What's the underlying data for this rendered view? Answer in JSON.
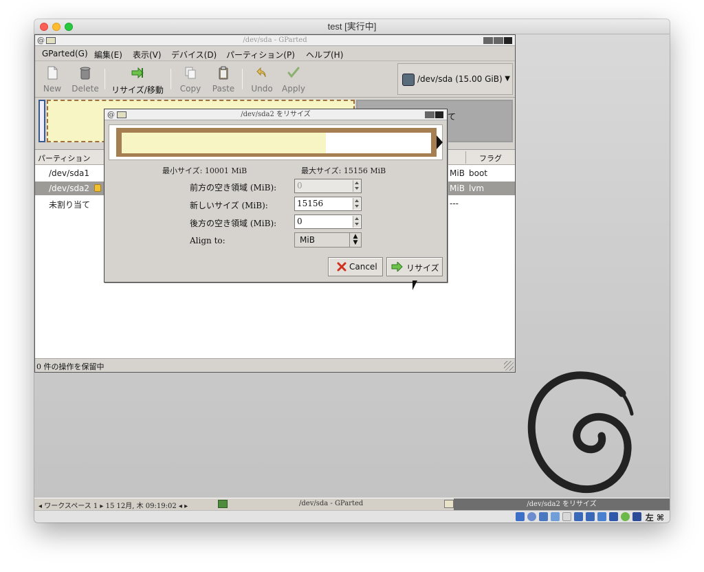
{
  "host": {
    "title": "test [実行中]"
  },
  "gparted": {
    "title": "/dev/sda - GParted",
    "menu": [
      "GParted(G)",
      "編集(E)",
      "表示(V)",
      "デバイス(D)",
      "パーティション(P)",
      "ヘルプ(H)"
    ],
    "toolbar": {
      "new": "New",
      "delete": "Delete",
      "resize_move": "リサイズ/移動",
      "copy": "Copy",
      "paste": "Paste",
      "undo": "Undo",
      "apply": "Apply"
    },
    "device": "/dev/sda  (15.00 GiB)",
    "graph_unalloc_fragment": "て",
    "columns": {
      "partition": "パーティション",
      "flags": "フラグ"
    },
    "rows": [
      {
        "partition": "/dev/sda1",
        "size_fragment": "MiB",
        "flags": "boot"
      },
      {
        "partition": "/dev/sda2",
        "size_fragment": "MiB",
        "flags": "lvm"
      },
      {
        "partition": "未割り当て",
        "size_fragment": "---",
        "flags": ""
      }
    ],
    "status": "0 件の操作を保留中"
  },
  "dialog": {
    "title": "/dev/sda2 をリサイズ",
    "resize_used_fraction": 0.66,
    "min_size": "最小サイズ: 10001 MiB",
    "max_size": "最大サイズ: 15156 MiB",
    "fields": {
      "free_before_label": "前方の空き領域 (MiB):",
      "free_before_value": "0",
      "new_size_label": "新しいサイズ (MiB):",
      "new_size_value": "15156",
      "free_after_label": "後方の空き領域 (MiB):",
      "free_after_value": "0",
      "align_label": "Align to:",
      "align_value": "MiB"
    },
    "buttons": {
      "cancel": "Cancel",
      "resize": "リサイズ"
    }
  },
  "taskbar": {
    "workspace": "◂ ワークスペース 1 ▸  15 12月, 木 09:19:02  ◂ ▸",
    "main_task": "/dev/sda - GParted",
    "dialog_task": "/dev/sda2 をリサイズ"
  },
  "vbox": {
    "hostkey": "左 ⌘"
  },
  "colors": {
    "used": "#f7f5c4",
    "partition_border": "#a57e52",
    "selection": "#9d9b98"
  }
}
